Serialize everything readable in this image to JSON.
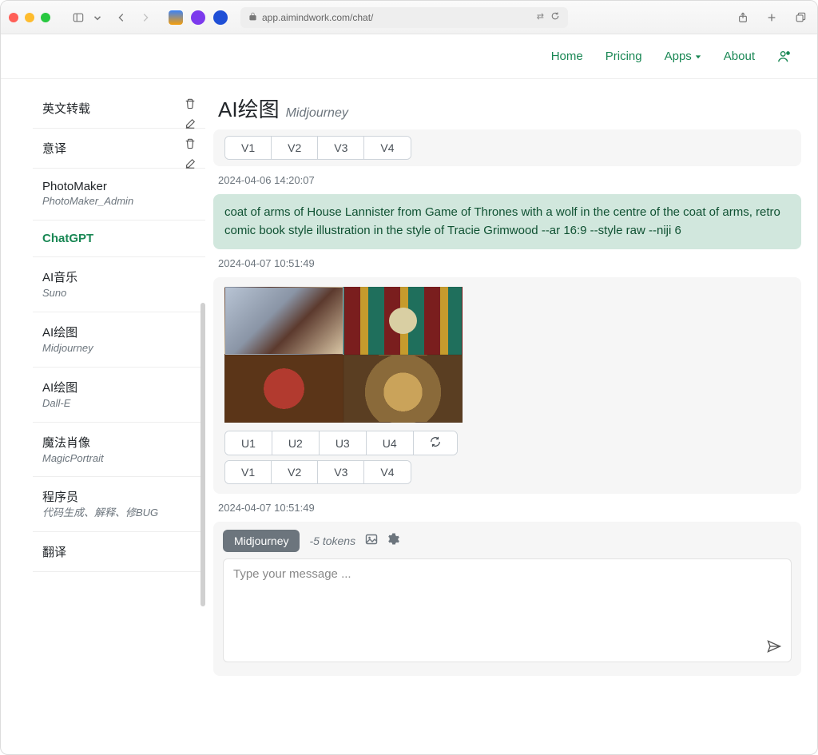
{
  "browser": {
    "url": "app.aimindwork.com/chat/"
  },
  "nav": {
    "home": "Home",
    "pricing": "Pricing",
    "apps": "Apps",
    "about": "About"
  },
  "page": {
    "title": "AI绘图",
    "tool": "Midjourney"
  },
  "sidebar": {
    "items": [
      {
        "title": "英文转载",
        "sub": "",
        "actions": true
      },
      {
        "title": "意译",
        "sub": "",
        "actions": true
      },
      {
        "title": "PhotoMaker",
        "sub": "PhotoMaker_Admin",
        "actions": false
      },
      {
        "title": "ChatGPT",
        "sub": "",
        "actions": false,
        "active": true
      },
      {
        "title": "AI音乐",
        "sub": "Suno",
        "actions": false
      },
      {
        "title": "AI绘图",
        "sub": "Midjourney",
        "actions": false
      },
      {
        "title": "AI绘图",
        "sub": "Dall-E",
        "actions": false
      },
      {
        "title": "魔法肖像",
        "sub": "MagicPortrait",
        "actions": false
      },
      {
        "title": "程序员",
        "sub": "代码生成、解释、修BUG",
        "actions": false
      },
      {
        "title": "翻译",
        "sub": "",
        "actions": false
      }
    ]
  },
  "chat": {
    "row0": {
      "v1": "V1",
      "v2": "V2",
      "v3": "V3",
      "v4": "V4"
    },
    "ts0": "2024-04-06 14:20:07",
    "prompt": "coat of arms of House Lannister from Game of Thrones with a wolf in the centre of the coat of arms, retro comic book style illustration in the style of Tracie Grimwood --ar 16:9 --style raw --niji 6",
    "ts1": "2024-04-07 10:51:49",
    "u": {
      "u1": "U1",
      "u2": "U2",
      "u3": "U3",
      "u4": "U4"
    },
    "v": {
      "v1": "V1",
      "v2": "V2",
      "v3": "V3",
      "v4": "V4"
    },
    "ts2": "2024-04-07 10:51:49"
  },
  "composer": {
    "model": "Midjourney",
    "tokens": "-5 tokens",
    "placeholder": "Type your message ..."
  }
}
